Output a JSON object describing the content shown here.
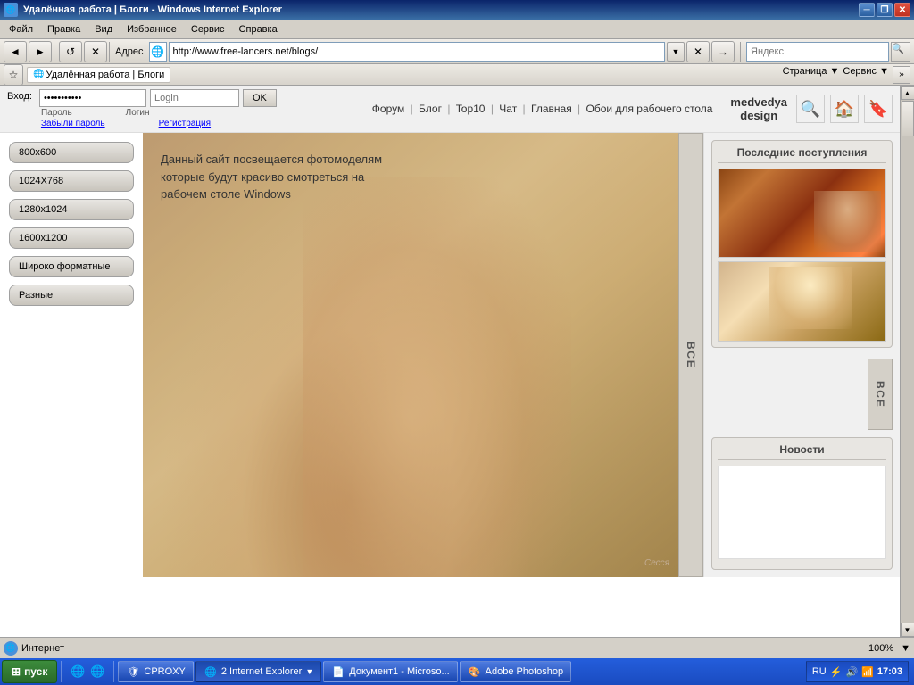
{
  "browser": {
    "title": "Удалённая работа | Блоги - Windows Internet Explorer",
    "address": "http://www.free-lancers.net/blogs/",
    "back_label": "◄",
    "forward_label": "►",
    "refresh_label": "↺",
    "stop_label": "✕",
    "go_label": "→",
    "search_placeholder": "Яндекс",
    "minimize": "─",
    "restore": "❐",
    "close": "✕"
  },
  "menubar": {
    "items": [
      "Файл",
      "Правка",
      "Вид",
      "Избранное",
      "Сервис",
      "Справка"
    ]
  },
  "favbar": {
    "label": "Удалённая работа | Блоги",
    "expand_label": "»"
  },
  "toolbar_right": {
    "items": [
      "Страница ▼",
      "Сервис ▼"
    ]
  },
  "site": {
    "nav_links": [
      "Форум",
      "Блог",
      "Top10",
      "Чат",
      "Главная",
      "Обои для рабочего стола"
    ],
    "nav_sep": "|",
    "login_label": "Вход:",
    "password_value": "***********",
    "login_input_placeholder": "Login",
    "ok_label": "OK",
    "password_label": "Пароль",
    "login_label2": "Логин",
    "forgot_password": "Забыли пароль",
    "register": "Регистрация",
    "brand_line1": "medvedya",
    "brand_line2": "design",
    "resolutions": [
      "800x600",
      "1024X768",
      "1280x1024",
      "1600x1200",
      "Широко форматные",
      "Разные"
    ],
    "all_label": "ВСЕ",
    "description": "Данный сайт посвещается фотомоделям которые будут красиво смотреться на рабочем столе Windows",
    "last_arrivals": "Последние поступления",
    "news": "Новости",
    "all_label2": "ВСЕ",
    "watermark": "Сесся"
  },
  "statusbar": {
    "zone": "Интернет",
    "zoom": "100%"
  },
  "taskbar": {
    "start_label": "пуск",
    "windows_btn": "2 Internet Explorer",
    "doc_btn": "Документ1 - Microsо...",
    "photoshop_btn": "Adobe Photoshop",
    "time": "17:03",
    "lang": "RU",
    "cproxy_label": "CPROXY",
    "ie_icon": "e",
    "quick_icons": [
      "e",
      "e"
    ]
  }
}
